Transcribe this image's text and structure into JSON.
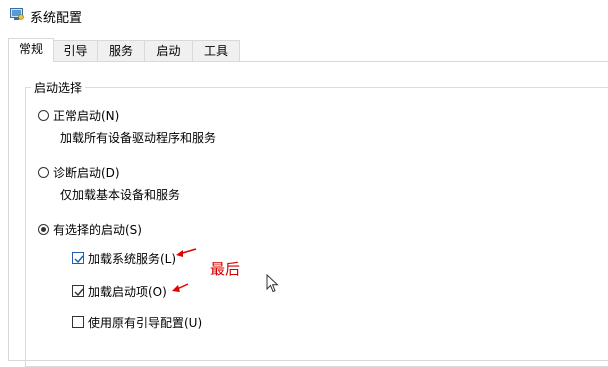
{
  "window": {
    "title": "系统配置",
    "icon": "msconfig-icon"
  },
  "tabs": [
    {
      "label": "常规",
      "active": true
    },
    {
      "label": "引导",
      "active": false
    },
    {
      "label": "服务",
      "active": false
    },
    {
      "label": "启动",
      "active": false
    },
    {
      "label": "工具",
      "active": false
    }
  ],
  "startup_selection": {
    "title": "启动选择",
    "normal": {
      "label": "正常启动(N)",
      "desc": "加载所有设备驱动程序和服务",
      "selected": false
    },
    "diagnostic": {
      "label": "诊断启动(D)",
      "desc": "仅加载基本设备和服务",
      "selected": false
    },
    "selective": {
      "label": "有选择的启动(S)",
      "selected": true,
      "options": [
        {
          "label": "加载系统服务(L)",
          "checked": true
        },
        {
          "label": "加载启动项(O)",
          "checked": true
        },
        {
          "label": "使用原有引导配置(U)",
          "checked": false
        }
      ]
    }
  },
  "annotation": {
    "text": "最后",
    "color": "#d40000"
  }
}
